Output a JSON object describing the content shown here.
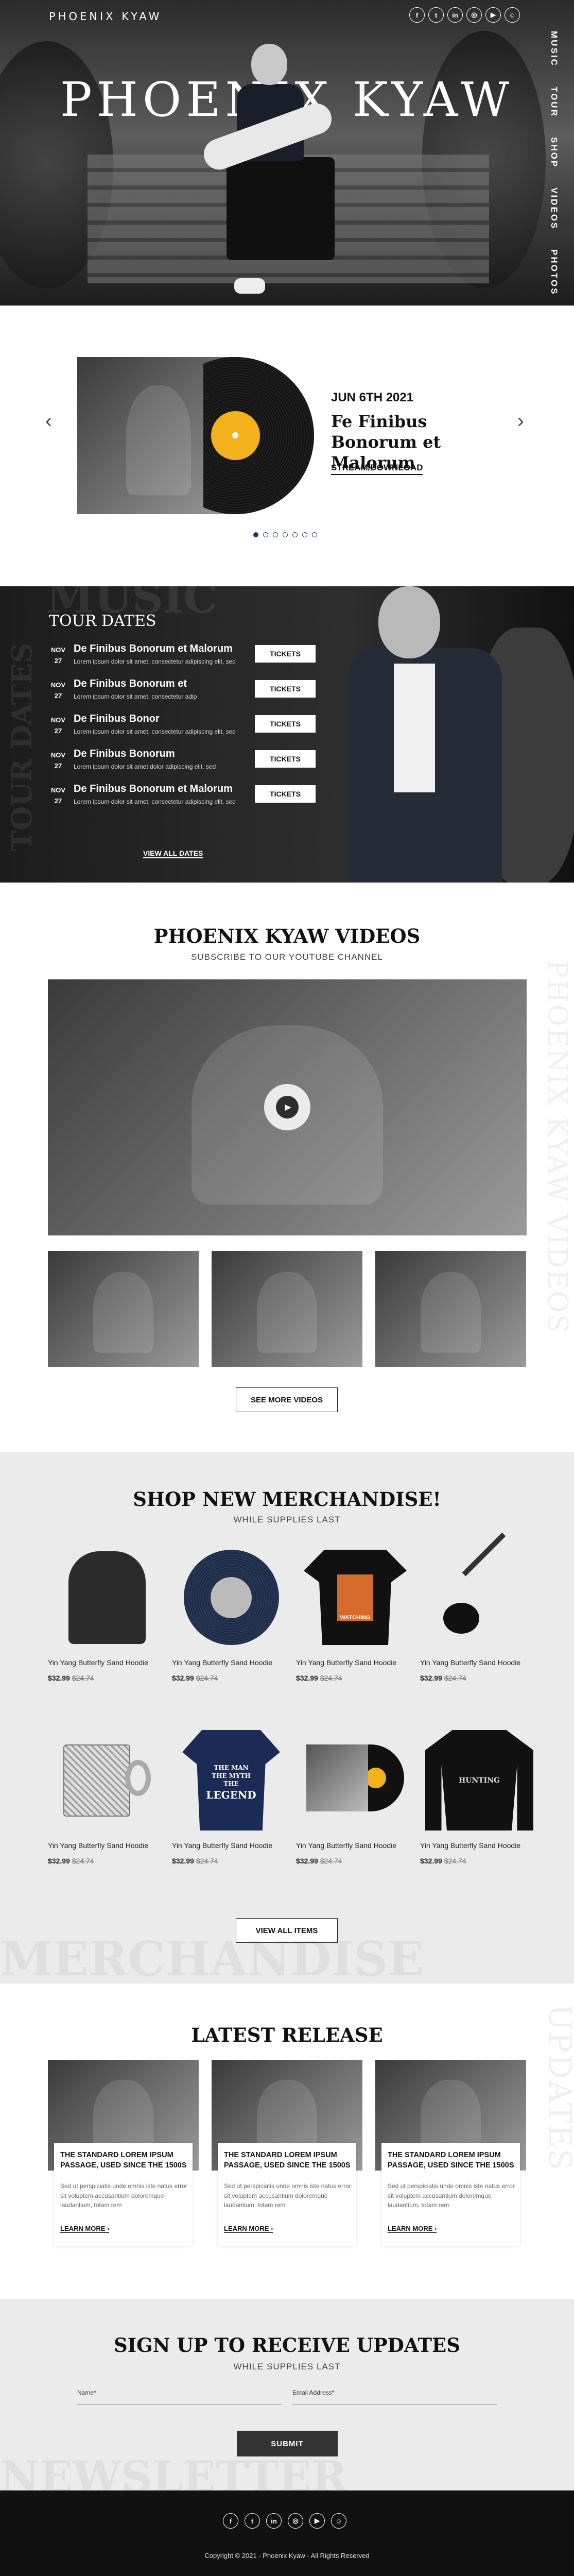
{
  "brand": {
    "logo": "PHOENIX KYAW",
    "hero_title": "PHOENIX KYAW"
  },
  "social": [
    {
      "icon": "facebook-icon",
      "glyph": "f"
    },
    {
      "icon": "twitter-icon",
      "glyph": "t"
    },
    {
      "icon": "linkedin-icon",
      "glyph": "in"
    },
    {
      "icon": "instagram-icon",
      "glyph": "◎"
    },
    {
      "icon": "youtube-icon",
      "glyph": "▶"
    },
    {
      "icon": "snapchat-icon",
      "glyph": "☺"
    }
  ],
  "side_nav": [
    "MUSIC",
    "TOUR",
    "SHOP",
    "VIDEOS",
    "PHOTOS"
  ],
  "release": {
    "date": "JUN 6TH 2021",
    "title": "Fe Finibus Bonorum et Malorum",
    "link": "STREAM/DOWNLOAD",
    "prev": "‹",
    "next": "›",
    "slides": 7,
    "active_slide": 0
  },
  "tour": {
    "ghost_top": "MUSIC",
    "ghost_side": "TOUR DATES",
    "title": "TOUR DATES",
    "rows": [
      {
        "month": "NOV",
        "day": "27",
        "name": "De Finibus Bonorum et Malorum",
        "desc": "Lorem ipsum dolor sit amet, consectetur adipiscing elit, sed",
        "ticket": "TICKETS"
      },
      {
        "month": "NOV",
        "day": "27",
        "name": "De Finibus Bonorum et",
        "desc": "Lorem ipsum dolor sit amet, consectetur adip",
        "ticket": "TICKETS"
      },
      {
        "month": "NOV",
        "day": "27",
        "name": "De Finibus Bonor",
        "desc": "Lorem ipsum dolor sit amet, consectetur adipiscing elit, sed",
        "ticket": "TICKETS"
      },
      {
        "month": "NOV",
        "day": "27",
        "name": "De Finibus Bonorum",
        "desc": "Lorem ipsum dolor sit amet dolor adipiscing elit, sed",
        "ticket": "TICKETS"
      },
      {
        "month": "NOV",
        "day": "27",
        "name": "De Finibus Bonorum et Malorum",
        "desc": "Lorem ipsum dolor sit amet, consectetur adipiscing elit, sed",
        "ticket": "TICKETS"
      }
    ],
    "view_all": "VIEW ALL DATES"
  },
  "videos": {
    "title": "PHOENIX KYAW VIDEOS",
    "subtitle": "SUBSCRIBE TO OUR YOUTUBE CHANNEL",
    "ghost": "PHOENIX KYAW VIDEOS",
    "button": "SEE MORE VIDEOS",
    "play": "▶"
  },
  "merch": {
    "title": "SHOP NEW MERCHANDISE!",
    "subtitle": "WHILE SUPPLIES LAST",
    "ghost": "MERCHANDISE",
    "button": "VIEW ALL ITEMS",
    "items": [
      {
        "name": "Yin Yang Butterfly Sand Hoodie",
        "price": "$32.99",
        "old": "$24.74",
        "kind": "hoodie"
      },
      {
        "name": "Yin Yang Butterfly Sand Hoodie",
        "price": "$32.99",
        "old": "$24.74",
        "kind": "vinyl"
      },
      {
        "name": "Yin Yang Butterfly Sand Hoodie",
        "price": "$32.99",
        "old": "$24.74",
        "kind": "tshirt"
      },
      {
        "name": "Yin Yang Butterfly Sand Hoodie",
        "price": "$32.99",
        "old": "$24.74",
        "kind": "guitar"
      },
      {
        "name": "Yin Yang Butterfly Sand Hoodie",
        "price": "$32.99",
        "old": "$24.74",
        "kind": "mug"
      },
      {
        "name": "Yin Yang Butterfly Sand Hoodie",
        "price": "$32.99",
        "old": "$24.74",
        "kind": "legend"
      },
      {
        "name": "Yin Yang Butterfly Sand Hoodie",
        "price": "$32.99",
        "old": "$24.74",
        "kind": "album"
      },
      {
        "name": "Yin Yang Butterfly Sand Hoodie",
        "price": "$32.99",
        "old": "$24.74",
        "kind": "longsleeve"
      }
    ],
    "shirt_text": "WATCHING",
    "legend_text": [
      "THE MAN",
      "THE MYTH",
      "THE",
      "LEGEND"
    ],
    "longsleeve_text": "HUNTING"
  },
  "latest": {
    "title": "LATEST RELEASE",
    "ghost": "UPDATES",
    "cards": [
      {
        "title": "THE STANDARD LOREM IPSUM PASSAGE, USED SINCE THE 1500S",
        "desc": "Sed ut perspiciatis unde omnis iste natus error sit voluptem accusantium doloremque laudantium, totam rem",
        "more": "LEARN MORE ›"
      },
      {
        "title": "THE STANDARD LOREM IPSUM PASSAGE, USED SINCE THE 1500S",
        "desc": "Sed ut perspiciatis unde omnis iste natus error sit voluptem accusantium doloremque laudantium, totam rem",
        "more": "LEARN MORE ›"
      },
      {
        "title": "THE STANDARD LOREM IPSUM PASSAGE, USED SINCE THE 1500S",
        "desc": "Sed ut perspiciatis unde omnis iste natus error sit voluptem accusantium doloremque laudantium, totam rem",
        "more": "LEARN MORE ›"
      }
    ]
  },
  "signup": {
    "title": "SIGN UP TO RECEIVE UPDATES",
    "subtitle": "WHILE SUPPLIES LAST",
    "ghost": "NEWSLETTER",
    "name_label": "Name*",
    "email_label": "Email Address*",
    "submit": "SUBMIT"
  },
  "footer": {
    "copyright": "Copyright © 2021 - Phoenix Kyaw - All Rights Reserved"
  },
  "colors": {
    "accent_yellow": "#f3b21b",
    "dark": "#111111",
    "dot_blue": "#1f3a68"
  }
}
